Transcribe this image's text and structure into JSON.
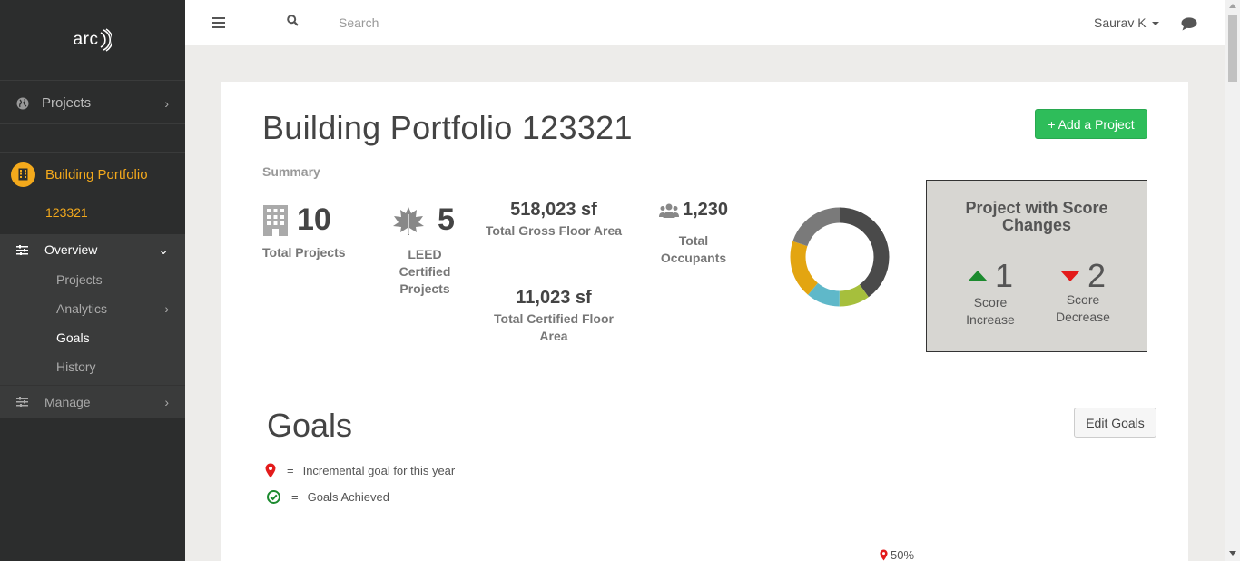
{
  "sidebar": {
    "logo_text": "arc",
    "projects_label": "Projects",
    "portfolio_title": "Building Portfolio",
    "portfolio_id": "123321",
    "overview_label": "Overview",
    "sub_items": [
      "Projects",
      "Analytics",
      "Goals",
      "History"
    ],
    "manage_label": "Manage",
    "accent_color": "#f3a91c"
  },
  "topbar": {
    "search_placeholder": "Search",
    "user_name": "Saurav K"
  },
  "main": {
    "title": "Building Portfolio 123321",
    "add_button": "+ Add a Project",
    "summary_label": "Summary",
    "stats": {
      "total_projects_value": "10",
      "total_projects_label": "Total Projects",
      "leed_value": "5",
      "leed_label_1": "LEED",
      "leed_label_2": "Certified",
      "leed_label_3": "Projects",
      "gross_area_value": "518,023 sf",
      "gross_area_label": "Total Gross Floor Area",
      "certified_area_value": "11,023 sf",
      "certified_area_label_1": "Total Certified Floor",
      "certified_area_label_2": "Area",
      "occupants_value": "1,230",
      "occupants_label_1": "Total",
      "occupants_label_2": "Occupants"
    },
    "score_box": {
      "title_1": "Project with Score",
      "title_2": "Changes",
      "increase_value": "1",
      "increase_label_1": "Score",
      "increase_label_2": "Increase",
      "decrease_value": "2",
      "decrease_label_1": "Score",
      "decrease_label_2": "Decrease"
    },
    "goals": {
      "title": "Goals",
      "edit_button": "Edit Goals",
      "legend_incremental": "Incremental goal for this year",
      "legend_achieved": "Goals Achieved",
      "equals": "=",
      "marker_value": "50%"
    }
  },
  "donut_segments": [
    {
      "value": 40,
      "color": "#4a4a4a"
    },
    {
      "value": 10,
      "color": "#a6bf3c"
    },
    {
      "value": 11,
      "color": "#5fb8c9"
    },
    {
      "value": 19,
      "color": "#e3a511"
    },
    {
      "value": 20,
      "color": "#7a7a7a"
    }
  ]
}
